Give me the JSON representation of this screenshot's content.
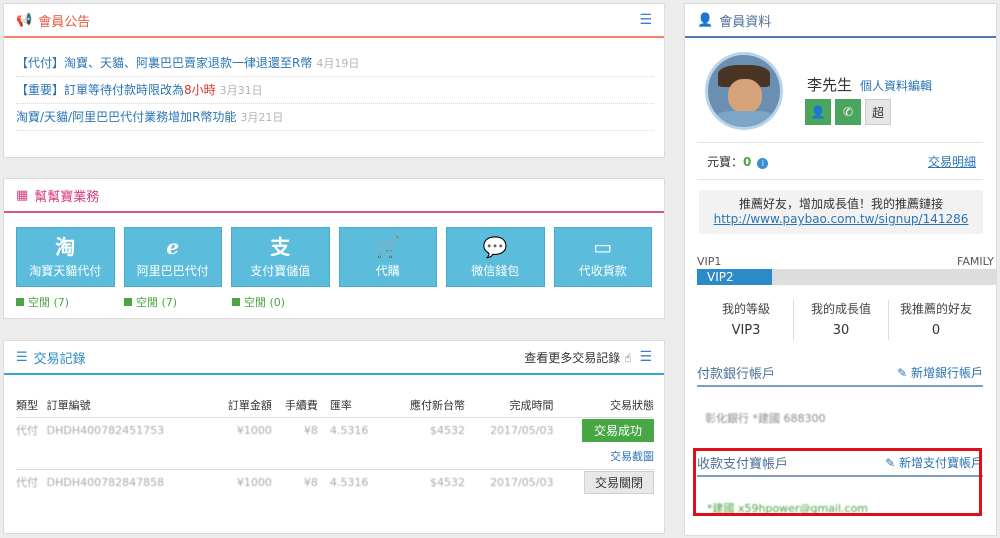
{
  "announcements": {
    "title": "會員公告",
    "items": [
      {
        "text": "【代付】淘寶、天貓、阿裏巴巴賣家退款一律退還至R幣",
        "highlight": "",
        "date": "4月19日"
      },
      {
        "text": "【重要】訂單等待付款時限改為",
        "highlight": "8小時",
        "date": "3月31日"
      },
      {
        "text": "淘寶/天貓/阿里巴巴代付業務增加R幣功能",
        "highlight": "",
        "date": "3月21日"
      }
    ]
  },
  "services": {
    "title": "幫幫寶業務",
    "tiles": [
      {
        "icon": "淘",
        "icon_name": "taobao-icon",
        "label": "淘寶天貓代付"
      },
      {
        "icon": "ℯ",
        "icon_name": "alibaba-icon",
        "label": "阿里巴巴代付"
      },
      {
        "icon": "支",
        "icon_name": "alipay-icon",
        "label": "支付寶儲值"
      },
      {
        "icon": "🛒",
        "icon_name": "cart-icon",
        "label": "代購"
      },
      {
        "icon": "💬",
        "icon_name": "wechat-icon",
        "label": "微信錢包"
      },
      {
        "icon": "▭",
        "icon_name": "card-icon",
        "label": "代收貨款"
      }
    ],
    "idle": [
      "空閒 (7)",
      "空閒 (7)",
      "空閒 (0)"
    ]
  },
  "transactions": {
    "title": "交易記錄",
    "more": "查看更多交易記錄",
    "headers": [
      "類型",
      "訂單編號",
      "訂單金額",
      "手續費",
      "匯率",
      "應付新台幣",
      "完成時間",
      "交易狀態"
    ],
    "rows": [
      {
        "type": "代付",
        "order": "DHDH400782451753",
        "amount": "¥1000",
        "fee": "¥8",
        "rate": "4.5316",
        "twd": "$4532",
        "time": "2017/05/03",
        "status": "交易成功",
        "extra": "交易截圖"
      },
      {
        "type": "代付",
        "order": "DHDH400782847858",
        "amount": "¥1000",
        "fee": "¥8",
        "rate": "4.5316",
        "twd": "$4532",
        "time": "2017/05/03",
        "status": "交易關閉",
        "extra": ""
      }
    ]
  },
  "member": {
    "title": "會員資料",
    "name": "李先生",
    "edit": "個人資料編輯",
    "badge_super": "超",
    "coin_label": "元寶：",
    "coin_value": "0",
    "tx_detail": "交易明細",
    "referral_text": "推薦好友，增加成長值！我的推薦鏈接",
    "referral_link": "http://www.paybao.com.tw/signup/141286",
    "vip_start": "VIP1",
    "vip_end": "FAMILY",
    "vip_current": "VIP2",
    "vip_progress": 0.25,
    "stats": [
      {
        "label": "我的等級",
        "value": "VIP3"
      },
      {
        "label": "我的成長值",
        "value": "30"
      },
      {
        "label": "我推薦的好友",
        "value": "0"
      }
    ],
    "bank_title": "付款銀行帳戶",
    "bank_add": "新增銀行帳戶",
    "bank_value": "彰化銀行 *建國 688300",
    "alipay_title": "收款支付寶帳戶",
    "alipay_add": "新增支付寶帳戶",
    "alipay_value": "*建國 x59hpower@gmail.com"
  }
}
